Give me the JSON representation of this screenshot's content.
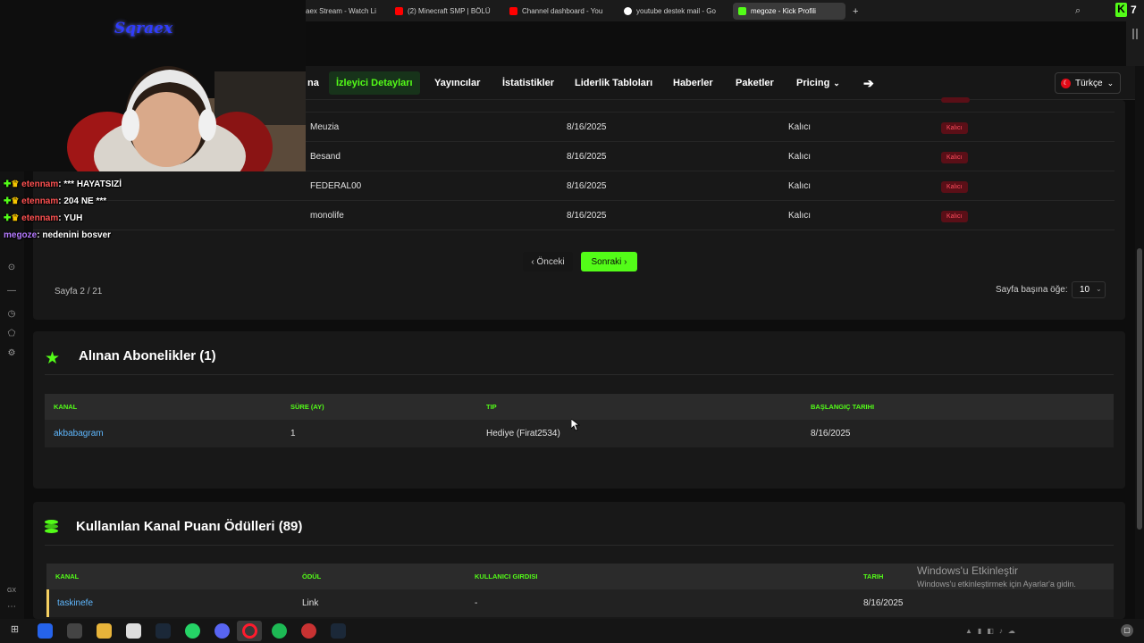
{
  "browser": {
    "tabs": [
      {
        "label": "aex Stream - Watch Li",
        "icon_color": "#e0e0e0"
      },
      {
        "label": "(2) Minecraft SMP | BÖLÜ",
        "icon_color": "#ff0000"
      },
      {
        "label": "Channel dashboard - You",
        "icon_color": "#ff0000"
      },
      {
        "label": "youtube destek mail - Go",
        "icon_color": "#ffffff"
      },
      {
        "label": "megoze - Kick Profili",
        "icon_color": "#53fc18"
      }
    ],
    "new_tab_label": "+",
    "ext_badge": "7"
  },
  "nav": {
    "items": [
      "na",
      "İzleyici Detayları",
      "Yayıncılar",
      "İstatistikler",
      "Liderlik Tabloları",
      "Haberler",
      "Paketler",
      "Pricing"
    ],
    "active_index": 1,
    "language": "Türkçe",
    "accent": "#53fc18"
  },
  "bans_table": {
    "rows": [
      {
        "name": "Meuzia",
        "date": "8/16/2025",
        "type": "Kalıcı",
        "badge": "Kalıcı"
      },
      {
        "name": "Besand",
        "date": "8/16/2025",
        "type": "Kalıcı",
        "badge": "Kalıcı"
      },
      {
        "name": "FEDERAL00",
        "date": "8/16/2025",
        "type": "Kalıcı",
        "badge": "Kalıcı"
      },
      {
        "name": "monolife",
        "date": "8/16/2025",
        "type": "Kalıcı",
        "badge": "Kalıcı"
      }
    ],
    "prev_label": "‹ Önceki",
    "next_label": "Sonraki ›",
    "page_info": "Sayfa 2 / 21",
    "per_page_label": "Sayfa başına öğe:",
    "per_page_value": "10"
  },
  "subscriptions": {
    "title": "Alınan Abonelikler (1)",
    "headers": [
      "KANAL",
      "SÜRE (AY)",
      "TIP",
      "BAŞLANGIÇ TARIHI"
    ],
    "rows": [
      {
        "channel": "akbabagram",
        "duration": "1",
        "type": "Hediye (Firat2534)",
        "start": "8/16/2025"
      }
    ]
  },
  "rewards": {
    "title": "Kullanılan Kanal Puanı Ödülleri (89)",
    "headers": [
      "KANAL",
      "ÖDÜL",
      "KULLANICI GIRDISI",
      "TARIH"
    ],
    "rows": [
      {
        "channel": "taskinefe",
        "reward": "Link",
        "input": "-",
        "date": "8/16/2025"
      }
    ]
  },
  "overlay": {
    "streamer_logo": "Sqraex",
    "chat": [
      {
        "user": "etennam",
        "message": ": *** HAYATSIZİ"
      },
      {
        "user": "etennam",
        "message": ": 204 NE ***"
      },
      {
        "user": "etennam",
        "message": ": YUH"
      },
      {
        "user": "megoze",
        "message": ": nedenini bosver"
      }
    ]
  },
  "windows_activation": {
    "title": "Windows'u Etkinleştir",
    "subtitle": "Windows'u etkinleştirmek için Ayarlar'a gidin."
  },
  "rail_label": "GX"
}
